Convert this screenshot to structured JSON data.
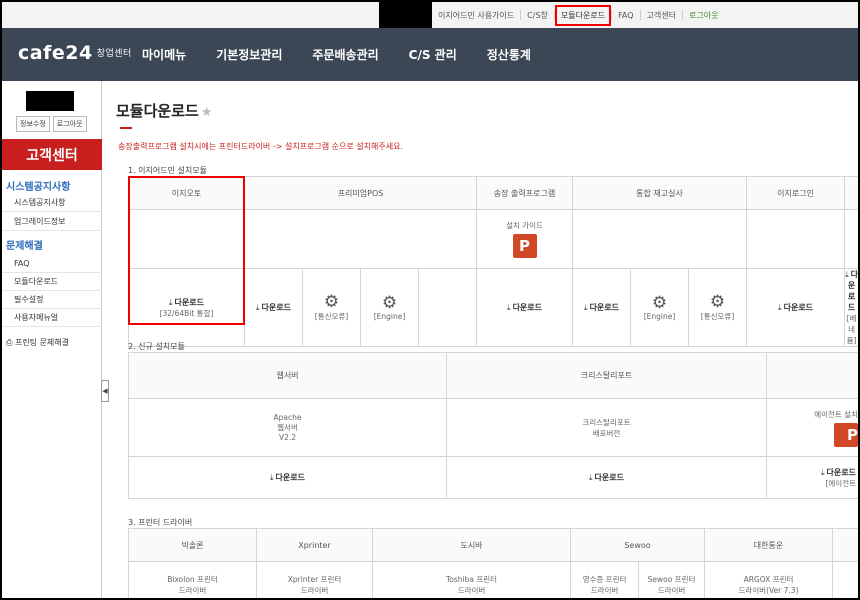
{
  "topbar": {
    "links": [
      "이지어드민 사용가이드",
      "C/S창",
      "모듈다운로드",
      "FAQ",
      "고객센터",
      "로그아웃"
    ]
  },
  "nav": {
    "logo": "cafe24",
    "logo_sub": "창업센터",
    "menu": [
      "마이메뉴",
      "기본정보관리",
      "주문배송관리",
      "C/S 관리",
      "정산통계"
    ]
  },
  "sidebar": {
    "user_buttons": [
      "정보수정",
      "로그아웃"
    ],
    "cs_title": "고객센터",
    "sections": [
      {
        "title": "시스템공지사항",
        "items": [
          "시스템공지사항",
          "업그레이드정보"
        ]
      },
      {
        "title": "문제해결",
        "items": [
          "FAQ",
          "모듈다운로드",
          "필수설정",
          "사용자메뉴얼"
        ]
      }
    ],
    "printer": "프린팅 문제해결"
  },
  "page": {
    "title": "모듈다운로드",
    "notice": "송장출력프로그램 설치시에는 프린터드라이버 -> 설치프로그램 순으로 설치해주세요."
  },
  "sec1": {
    "title": "1. 이지어드민 설치모듈",
    "headers": [
      "이지오토",
      "프리미엄POS",
      "송장 출력프로그램",
      "통합 재고실사",
      "이지로그인"
    ],
    "guide": "설치 가이드",
    "download": "다운로드",
    "autoNote": "[32/64Bit 통합]",
    "tags": {
      "comm": "[통신오류]",
      "engine": "[Engine]",
      "beta": "[베네퓸]"
    }
  },
  "sec2": {
    "title": "2. 신규 설치모듈",
    "headers": [
      "웹서버",
      "크리스탈리포트",
      ""
    ],
    "web": {
      "l1": "Apache",
      "l2": "웹서버",
      "l3": "V2.2"
    },
    "crystal": {
      "l1": "크리스탈리포트",
      "l2": "배포버전"
    },
    "agent": "에이전트 설치",
    "agentNote": "[에이전트"
  },
  "sec3": {
    "title": "3. 프린터 드라이버",
    "headers": [
      "빅솔론",
      "Xprinter",
      "도시바",
      "Sewoo",
      "대한통운"
    ],
    "cells": [
      {
        "l1": "Bixolon 프린터",
        "l2": "드라이버"
      },
      {
        "l1": "Xprinter 프린터",
        "l2": "드라이버"
      },
      {
        "l1": "Toshiba 프린터",
        "l2": "드라이버"
      },
      {
        "l1": "영수증 프린터",
        "l2": "드라이버"
      },
      {
        "l1": "Sewoo 프린터",
        "l2": "드라이버"
      },
      {
        "l1": "ARGOX 프린터",
        "l2": "드라이버(Ver 7.3)"
      }
    ]
  }
}
